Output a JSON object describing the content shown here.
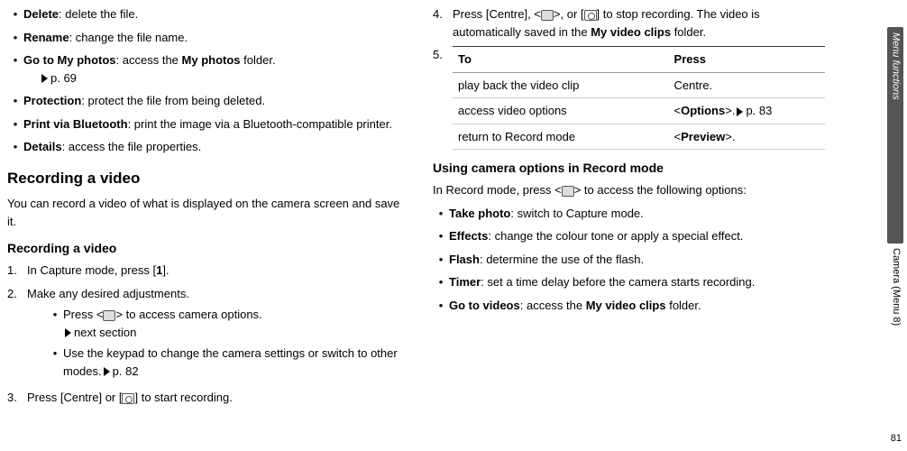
{
  "left": {
    "items": [
      {
        "term": "Delete",
        "desc": ": delete the file."
      },
      {
        "term": "Rename",
        "desc": ": change the file name."
      },
      {
        "term": "Go to My photos",
        "desc_pre": ": access the ",
        "desc_bold": "My photos",
        "desc_post": " folder.",
        "ref": "p. 69"
      },
      {
        "term": "Protection",
        "desc": ": protect the file from being deleted."
      },
      {
        "term": "Print via Bluetooth",
        "desc": ": print the image via a Bluetooth-compatible printer."
      },
      {
        "term": "Details",
        "desc": ": access the file properties."
      }
    ],
    "h_rec": "Recording a video",
    "p_rec": "You can record a video of what is displayed on the camera screen and save it.",
    "h_rec2": "Recording a video",
    "step1_a": "In Capture mode, press [",
    "step1_b": "1",
    "step1_c": "].",
    "step2": "Make any desired adjustments.",
    "sub1_a": "Press <",
    "sub1_b": "> to access camera options.",
    "sub1_ref": "next section",
    "sub2_a": "Use the keypad to change the camera settings or switch to other modes.",
    "sub2_ref": "p. 82",
    "step3_a": "Press [Centre] or [",
    "step3_b": "] to start recording."
  },
  "right": {
    "step4_a": "Press [Centre], <",
    "step4_b": ">, or [",
    "step4_c": "] to stop recording. The video is automatically saved in the ",
    "step4_bold": "My video clips",
    "step4_d": " folder.",
    "step5": "5.",
    "th1": "To",
    "th2": "Press",
    "rows": [
      {
        "to": "play back the video clip",
        "press": "Centre."
      },
      {
        "to": "access video options",
        "press_pre": "<",
        "press_b": "Options",
        "press_post": ">.",
        "ref": "p. 83"
      },
      {
        "to": "return to Record mode",
        "press_pre": "<",
        "press_b": "Preview",
        "press_post": ">."
      }
    ],
    "h_opts": "Using camera options in Record mode",
    "p_opts_a": "In Record mode, press <",
    "p_opts_b": "> to access the following options:",
    "items": [
      {
        "term": "Take photo",
        "desc": ": switch to Capture mode."
      },
      {
        "term": "Effects",
        "desc": ": change the colour tone or apply a special effect."
      },
      {
        "term": "Flash",
        "desc": ": determine the use of the flash."
      },
      {
        "term": "Timer",
        "desc": ": set a time delay before the camera starts recording."
      },
      {
        "term": "Go to videos",
        "desc_pre": ": access the ",
        "desc_bold": "My video clips",
        "desc_post": " folder."
      }
    ]
  },
  "side": {
    "mf": "Menu functions",
    "sub": "Camera (Menu 8)"
  },
  "page": "81"
}
